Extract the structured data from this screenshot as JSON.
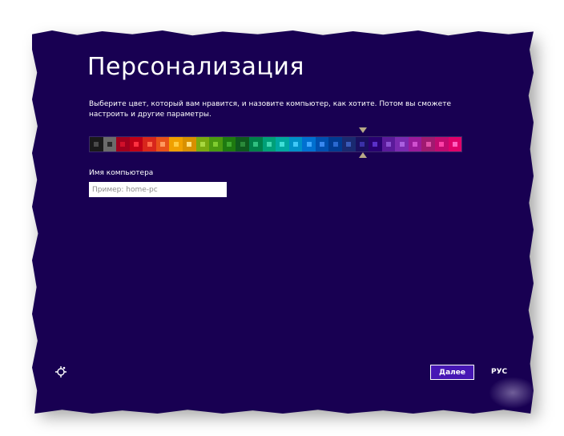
{
  "page": {
    "title": "Персонализация",
    "description": "Выберите цвет, который вам нравится, и назовите компьютер, как хотите. Потом вы сможете настроить и другие параметры."
  },
  "palette": {
    "selected_index": 21,
    "swatches": [
      {
        "bg": "#1a1a1a",
        "sq": "#4a4a4a"
      },
      {
        "bg": "#6b6b6b",
        "sq": "#2a2a2a"
      },
      {
        "bg": "#a0001e",
        "sq": "#d0102a"
      },
      {
        "bg": "#c00016",
        "sq": "#ff3040"
      },
      {
        "bg": "#d8261c",
        "sq": "#ff6a4a"
      },
      {
        "bg": "#e8521a",
        "sq": "#ff9a60"
      },
      {
        "bg": "#f0a000",
        "sq": "#ffcc40"
      },
      {
        "bg": "#d89000",
        "sq": "#ffe080"
      },
      {
        "bg": "#7aaa10",
        "sq": "#a8d840"
      },
      {
        "bg": "#4a9a10",
        "sq": "#80cc30"
      },
      {
        "bg": "#1e7a10",
        "sq": "#40aa30"
      },
      {
        "bg": "#0e5a1e",
        "sq": "#2a8a3a"
      },
      {
        "bg": "#00804a",
        "sq": "#30c080"
      },
      {
        "bg": "#00a078",
        "sq": "#40d8b0"
      },
      {
        "bg": "#00a8a0",
        "sq": "#40e0d8"
      },
      {
        "bg": "#0090c8",
        "sq": "#40c8f8"
      },
      {
        "bg": "#0070d0",
        "sq": "#40a8ff"
      },
      {
        "bg": "#0050b0",
        "sq": "#3a88f0"
      },
      {
        "bg": "#003a90",
        "sq": "#2a68d0"
      },
      {
        "bg": "#1a2a70",
        "sq": "#3a5ab8"
      },
      {
        "bg": "#1a1060",
        "sq": "#3a30a8"
      },
      {
        "bg": "#280070",
        "sq": "#5a30c8"
      },
      {
        "bg": "#5a1a9a",
        "sq": "#8a50d0"
      },
      {
        "bg": "#7a2ab0",
        "sq": "#aa60e0"
      },
      {
        "bg": "#9a1a9a",
        "sq": "#d050d0"
      },
      {
        "bg": "#a01a70",
        "sq": "#e050a8"
      },
      {
        "bg": "#c00a70",
        "sq": "#ff40a8"
      },
      {
        "bg": "#e0006a",
        "sq": "#ff60c0"
      }
    ]
  },
  "computer_name": {
    "label": "Имя компьютера",
    "placeholder": "Пример: home-pc"
  },
  "footer": {
    "next_label": "Далее",
    "language": "РУС"
  }
}
